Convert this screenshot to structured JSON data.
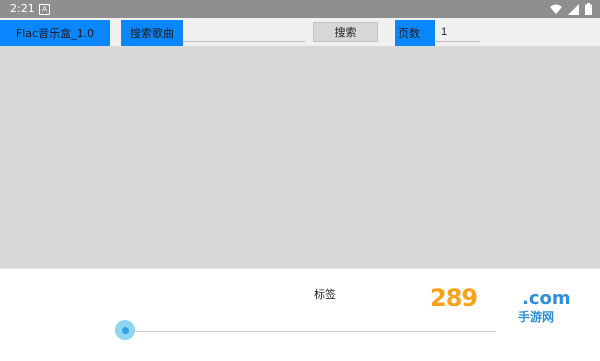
{
  "statusbar": {
    "time": "2:21",
    "notif_icon_letter": "A",
    "icons": [
      "wifi-icon",
      "signal-icon",
      "battery-icon"
    ]
  },
  "toolbar": {
    "app_title": "Flac音乐盒_1.0",
    "search_label": "搜索歌曲",
    "search_value": "",
    "search_button": "搜索",
    "page_label": "页数",
    "page_value": "1"
  },
  "player": {
    "tag_label": "标签",
    "progress": 0
  },
  "watermark": {
    "main": "289",
    "suffix": ".com",
    "sub": "手游网"
  },
  "colors": {
    "accent": "#0a87ff",
    "content_bg": "#d8d8d8",
    "thumb": "#8fd4f0"
  }
}
